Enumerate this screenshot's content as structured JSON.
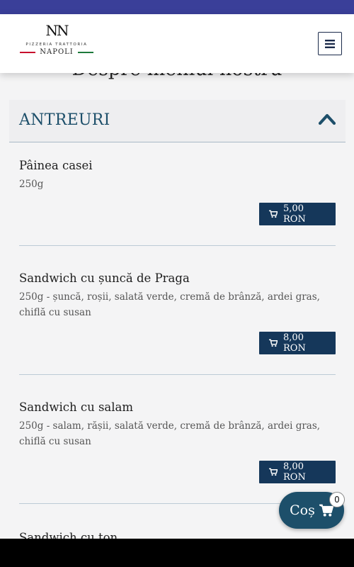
{
  "header": {
    "logo_monogram": "NN",
    "logo_subtitle": "PIZZERIA TRATTORIA",
    "logo_city": "NAPOLI",
    "flag_colors": [
      "#c8102e",
      "#ffffff",
      "#1e7a3c"
    ]
  },
  "section": {
    "title": "Despre meniul nostru"
  },
  "category": {
    "title": "ANTREURI",
    "expanded": true
  },
  "items": [
    {
      "name": "Pâinea casei",
      "desc": "250g",
      "price": "5,00 RON"
    },
    {
      "name": "Sandwich cu șuncă de Praga",
      "desc": "250g - șuncă, roșii, salată verde, cremă de brânză, ardei gras, chiflă cu susan",
      "price": "8,00 RON"
    },
    {
      "name": "Sandwich cu salam",
      "desc": "250g - salam, rășii, salată verde, cremă de brânză, ardei gras, chiflă cu susan",
      "price": "8,00 RON"
    },
    {
      "name": "Sandwich cu ton",
      "desc": "",
      "price": ""
    }
  ],
  "cart": {
    "label": "Coș",
    "count": "0"
  },
  "icons": {
    "menu": "hamburger-menu-icon",
    "cart": "shopping-cart-icon",
    "chevron": "chevron-up-icon"
  },
  "colors": {
    "topbar": "#3a3f99",
    "accent": "#15375a",
    "category_text": "#1d4f6a"
  }
}
